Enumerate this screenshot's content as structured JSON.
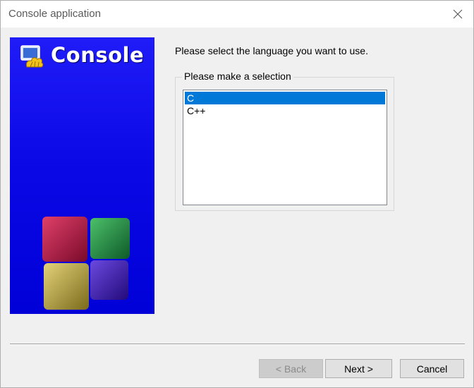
{
  "window": {
    "title": "Console application",
    "close_icon": "close-icon"
  },
  "banner": {
    "title": "Console",
    "logo_icon": "console-wizard-icon",
    "colors": {
      "background": "#0a08e6",
      "cube_red": "#b0183a",
      "cube_green": "#1f8a3a",
      "cube_yellow": "#b8a33a",
      "cube_purple": "#3a14b0"
    }
  },
  "content": {
    "prompt": "Please select the language you want to use.",
    "group_label": "Please make a selection",
    "languages": [
      {
        "label": "C",
        "selected": true
      },
      {
        "label": "C++",
        "selected": false
      }
    ]
  },
  "buttons": {
    "back": {
      "label": "< Back",
      "enabled": false
    },
    "next": {
      "label": "Next >",
      "enabled": true
    },
    "cancel": {
      "label": "Cancel",
      "enabled": true
    }
  },
  "colors": {
    "selection": "#0078d7",
    "window_bg": "#f0f0f0"
  }
}
